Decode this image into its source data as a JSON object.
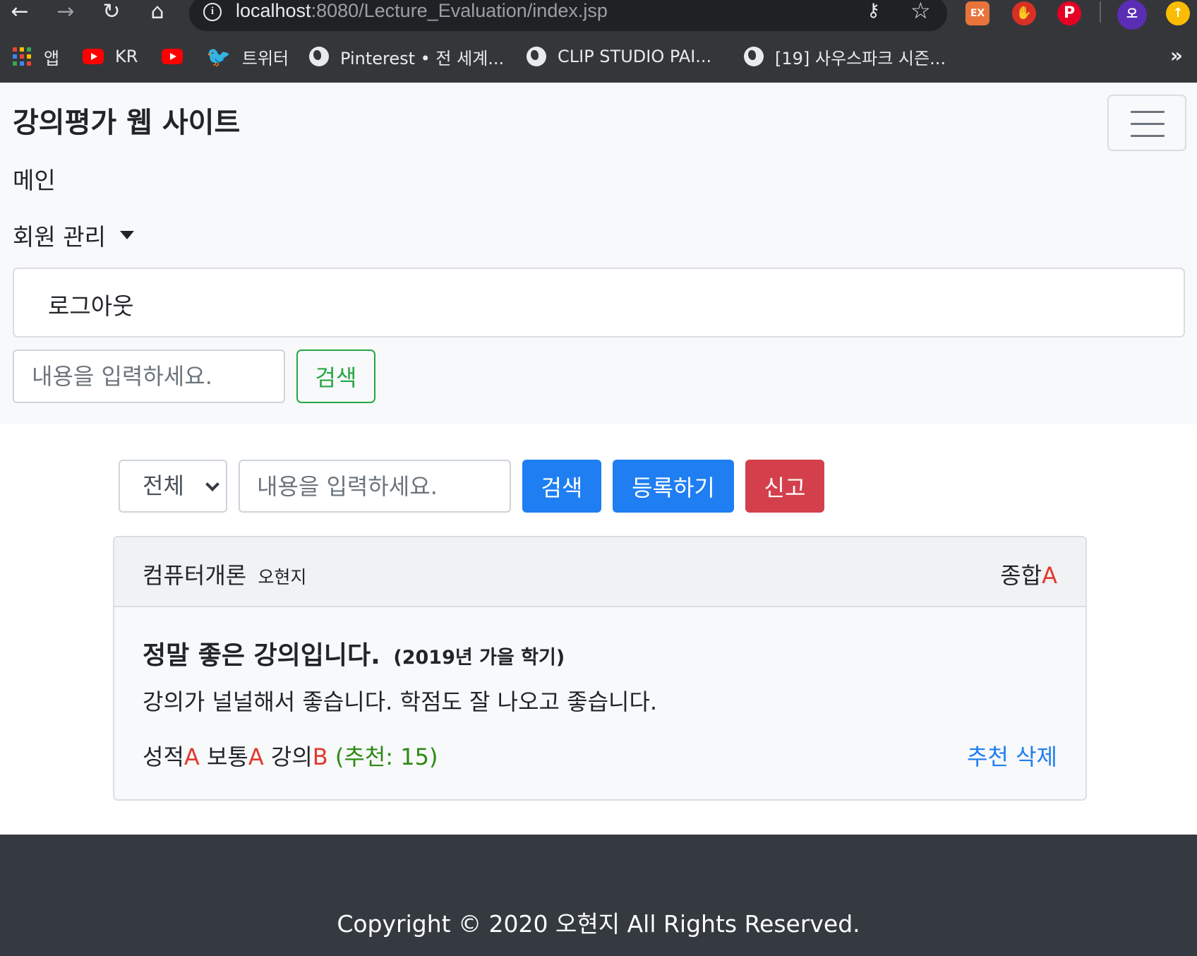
{
  "browser": {
    "url_host": "localhost",
    "url_path": ":8080/Lecture_Evaluation/index.jsp",
    "extensions": {
      "ex_label": "EX",
      "profile_initial": "오"
    },
    "bookmarks": [
      {
        "label": "앱",
        "icon": "apps-grid-icon"
      },
      {
        "label": "KR",
        "icon": "youtube-icon"
      },
      {
        "label": "",
        "icon": "youtube-icon"
      },
      {
        "label": "트위터",
        "icon": "twitter-icon"
      },
      {
        "label": "Pinterest • 전 세계...",
        "icon": "globe-icon"
      },
      {
        "label": "CLIP STUDIO PAI...",
        "icon": "globe-icon"
      },
      {
        "label": "[19] 사우스파크 시즌...",
        "icon": "globe-icon"
      }
    ],
    "more_label": "»"
  },
  "navbar": {
    "brand": "강의평가 웹 사이트",
    "main_link": "메인",
    "member_dropdown": "회원 관리",
    "dropdown_items": [
      "로그아웃"
    ],
    "search_placeholder": "내용을 입력하세요.",
    "search_button": "검색"
  },
  "search_bar": {
    "selected_filter": "전체",
    "placeholder": "내용을 입력하세요.",
    "search_button": "검색",
    "register_button": "등록하기",
    "report_button": "신고"
  },
  "evaluations": [
    {
      "lecture_name": "컴퓨터개론",
      "professor": "오현지",
      "overall_label": "종합",
      "overall_score": "A",
      "title": "정말 좋은 강의입니다.",
      "semester": "(2019년 가을 학기)",
      "content": "강의가 널널해서 좋습니다. 학점도 잘 나오고 좋습니다.",
      "credit_label": "성적",
      "credit_score": "A",
      "comfortable_label": "보통",
      "comfortable_score": "A",
      "lecture_label": "강의",
      "lecture_score": "B",
      "likes": "(추천: 15)",
      "like_action": "추천",
      "delete_action": "삭제"
    }
  ],
  "footer": {
    "copyright": "Copyright © 2020 오현지 All Rights Reserved."
  },
  "colors": {
    "primary": "#1f7ef2",
    "danger": "#d3404c",
    "success": "#28a745",
    "grade_red": "#e03a2e",
    "likes_green": "#2d8a14",
    "footer_bg": "#343a40",
    "browser_chrome": "#35363a"
  }
}
